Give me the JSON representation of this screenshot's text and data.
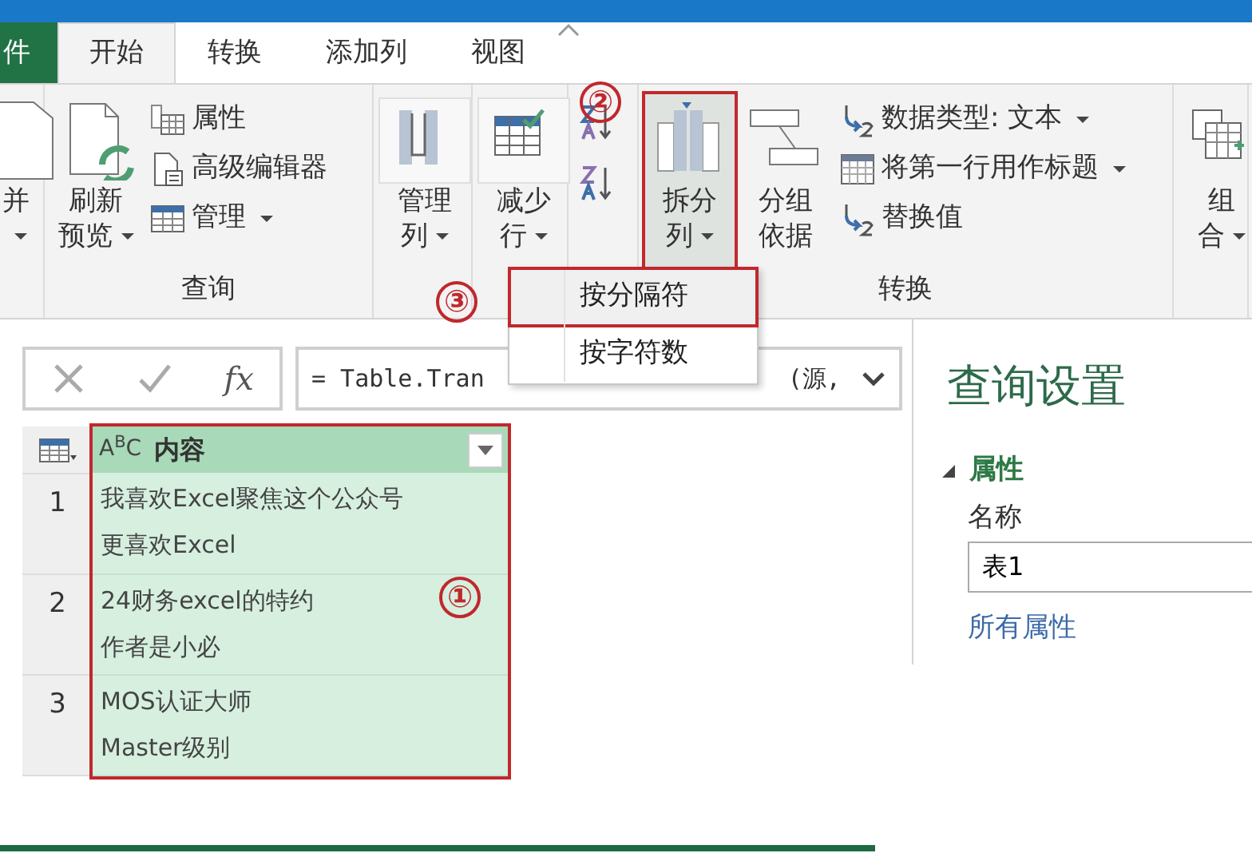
{
  "tabs": [
    {
      "label": "件",
      "kind": "file",
      "selected": false
    },
    {
      "label": "开始",
      "kind": "tab",
      "selected": true
    },
    {
      "label": "转换",
      "kind": "tab",
      "selected": false
    },
    {
      "label": "添加列",
      "kind": "tab",
      "selected": false
    },
    {
      "label": "视图",
      "kind": "tab",
      "selected": false
    }
  ],
  "ribbon_groups": [
    {
      "items": [
        {
          "kind": "large",
          "lines": [
            "并"
          ],
          "dropdown": true,
          "pressed": false,
          "outlined": false
        }
      ]
    },
    {
      "label": "查询",
      "items": [
        {
          "kind": "large",
          "lines": [
            "刷新",
            "预览"
          ],
          "dropdown": true,
          "pressed": false,
          "outlined": false
        },
        {
          "kind": "small",
          "label": "属性",
          "dropdown": false
        },
        {
          "kind": "small",
          "label": "高级编辑器",
          "dropdown": false
        },
        {
          "kind": "small",
          "label": "管理",
          "dropdown": true
        }
      ]
    },
    {
      "items": [
        {
          "kind": "large",
          "lines": [
            "管理",
            "列"
          ],
          "dropdown": true,
          "pressed": false,
          "outlined": false
        }
      ]
    },
    {
      "items": [
        {
          "kind": "large",
          "lines": [
            "减少",
            "行"
          ],
          "dropdown": true,
          "pressed": false,
          "outlined": false
        }
      ]
    },
    {
      "items": [
        {
          "kind": "sort"
        },
        {
          "kind": "sort"
        }
      ]
    },
    {
      "label": "转换",
      "items": [
        {
          "kind": "large",
          "lines": [
            "拆分",
            "列"
          ],
          "dropdown": true,
          "pressed": true,
          "outlined": true
        },
        {
          "kind": "large",
          "lines": [
            "分组",
            "依据"
          ],
          "dropdown": false,
          "pressed": false,
          "outlined": false
        },
        {
          "kind": "small",
          "label": "数据类型: 文本",
          "dropdown": true
        },
        {
          "kind": "small",
          "label": "将第一行用作标题",
          "dropdown": true
        },
        {
          "kind": "small",
          "label": "替换值",
          "dropdown": false
        }
      ]
    },
    {
      "items": [
        {
          "kind": "large",
          "lines": [
            "组",
            "合"
          ],
          "dropdown": true,
          "pressed": false,
          "outlined": false
        }
      ]
    }
  ],
  "split_menu": {
    "items": [
      {
        "label": "按分隔符",
        "selected": true,
        "outlined": true
      },
      {
        "label": "按字符数",
        "selected": false,
        "outlined": false
      }
    ]
  },
  "formula_bar": {
    "fx": "fx",
    "visible_text": [
      "= Table.Tran",
      "(源,"
    ]
  },
  "table": {
    "columns": [
      {
        "type": "A$^{B}$C",
        "name": "内容",
        "outlined": true
      }
    ],
    "rows": [
      {
        "number": "1",
        "lines": [
          "我喜欢Excel聚焦这个公众号",
          "更喜欢Excel"
        ]
      },
      {
        "number": "2",
        "lines": [
          "24财务excel的特约",
          "作者是小必"
        ]
      },
      {
        "number": "3",
        "lines": [
          "MOS认证大师",
          "Master级别"
        ]
      }
    ]
  },
  "query_settings": {
    "title": "查询设置",
    "section": {
      "label": "属性",
      "expanded": true
    },
    "name_label": "名称",
    "name_value": "表1",
    "link": "所有属性"
  },
  "callouts": [
    {
      "number": "②"
    },
    {
      "number": "③"
    },
    {
      "number": "①"
    }
  ]
}
